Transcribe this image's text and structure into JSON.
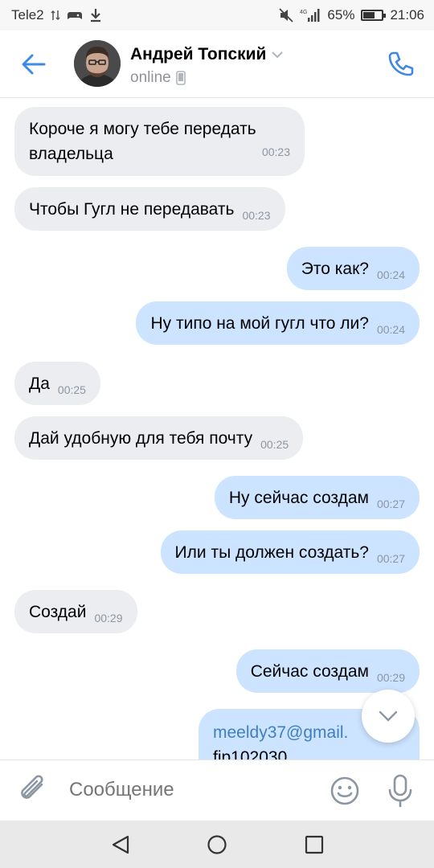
{
  "status_bar": {
    "carrier": "Tele2",
    "network": "4G",
    "battery_percent": "65%",
    "battery_level": 0.65,
    "time": "21:06",
    "icons": [
      "data-arrows-icon",
      "game-controller-icon",
      "download-icon",
      "mute-icon",
      "signal-icon",
      "battery-icon"
    ]
  },
  "header": {
    "contact_name": "Андрей Топский",
    "status": "online",
    "icons": [
      "back-arrow-icon",
      "avatar",
      "chevron-down-icon",
      "mobile-icon",
      "phone-icon"
    ],
    "accent_color": "#3f8ae0"
  },
  "messages": [
    {
      "dir": "in",
      "lines": [
        "Короче я могу тебе передать",
        "владельца"
      ],
      "time": "00:23"
    },
    {
      "dir": "in",
      "lines": [
        "Чтобы Гугл не передавать"
      ],
      "time": "00:23"
    },
    {
      "dir": "out",
      "lines": [
        "Это как?"
      ],
      "time": "00:24"
    },
    {
      "dir": "out",
      "lines": [
        "Ну типо на мой гугл что ли?"
      ],
      "time": "00:24"
    },
    {
      "dir": "in",
      "lines": [
        "Да"
      ],
      "time": "00:25"
    },
    {
      "dir": "in",
      "lines": [
        "Дай удобную для тебя почту"
      ],
      "time": "00:25"
    },
    {
      "dir": "out",
      "lines": [
        "Ну сейчас создам"
      ],
      "time": "00:27"
    },
    {
      "dir": "out",
      "lines": [
        "Или ты должен создать?"
      ],
      "time": "00:27"
    },
    {
      "dir": "in",
      "lines": [
        "Создай"
      ],
      "time": "00:29"
    },
    {
      "dir": "out",
      "lines": [
        "Сейчас создам"
      ],
      "time": "00:29"
    },
    {
      "dir": "out",
      "lines": [
        "meeldy37@gmail.",
        "fip102030"
      ],
      "link_line": 0
    }
  ],
  "composer": {
    "placeholder": "Сообщение",
    "icons": [
      "paperclip-icon",
      "emoji-icon",
      "microphone-icon"
    ]
  },
  "scroll_button": {
    "icon": "chevron-down-icon"
  },
  "nav_bar": {
    "icons": [
      "nav-back-icon",
      "nav-home-icon",
      "nav-recent-icon"
    ]
  },
  "colors": {
    "incoming_bubble": "#ebedf0",
    "outgoing_bubble": "#cce4ff",
    "link": "#3f7fc1",
    "timestamp": "#8c96a3"
  }
}
